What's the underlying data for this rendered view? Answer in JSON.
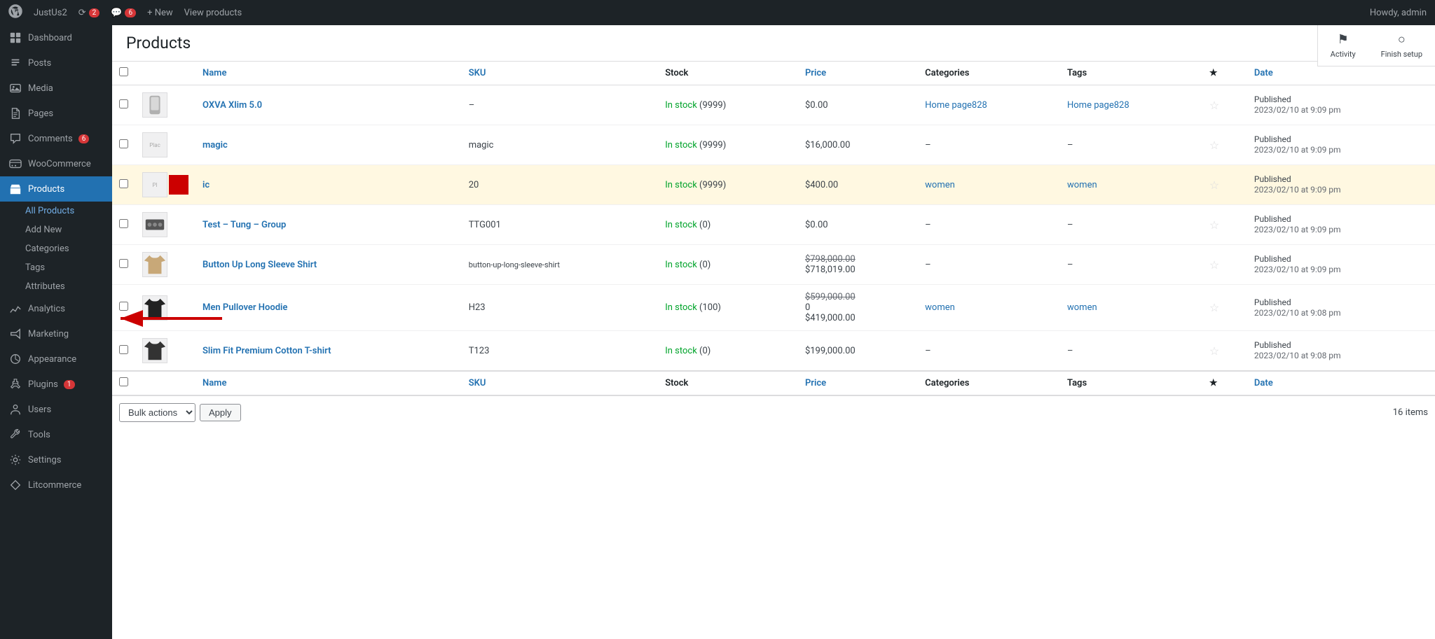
{
  "adminbar": {
    "site_name": "JustUs2",
    "updates_count": "2",
    "comments_count": "6",
    "new_label": "+ New",
    "view_products": "View products",
    "howdy": "Howdy, admin"
  },
  "sidebar": {
    "items": [
      {
        "id": "dashboard",
        "label": "Dashboard",
        "icon": "dashboard"
      },
      {
        "id": "posts",
        "label": "Posts",
        "icon": "posts"
      },
      {
        "id": "media",
        "label": "Media",
        "icon": "media"
      },
      {
        "id": "pages",
        "label": "Pages",
        "icon": "pages"
      },
      {
        "id": "comments",
        "label": "Comments",
        "icon": "comments",
        "badge": "6"
      },
      {
        "id": "woocommerce",
        "label": "WooCommerce",
        "icon": "woo"
      },
      {
        "id": "products",
        "label": "Products",
        "icon": "products",
        "active": true
      }
    ],
    "submenu": [
      {
        "id": "all-products",
        "label": "All Products",
        "active": true
      },
      {
        "id": "add-new",
        "label": "Add New"
      },
      {
        "id": "categories",
        "label": "Categories"
      },
      {
        "id": "tags",
        "label": "Tags"
      },
      {
        "id": "attributes",
        "label": "Attributes"
      }
    ],
    "bottom_items": [
      {
        "id": "analytics",
        "label": "Analytics",
        "icon": "analytics"
      },
      {
        "id": "marketing",
        "label": "Marketing",
        "icon": "marketing"
      },
      {
        "id": "appearance",
        "label": "Appearance",
        "icon": "appearance"
      },
      {
        "id": "plugins",
        "label": "Plugins",
        "icon": "plugins",
        "badge": "1"
      },
      {
        "id": "users",
        "label": "Users",
        "icon": "users"
      },
      {
        "id": "tools",
        "label": "Tools",
        "icon": "tools"
      },
      {
        "id": "settings",
        "label": "Settings",
        "icon": "settings"
      },
      {
        "id": "litcommerce",
        "label": "Litcommerce",
        "icon": "litcommerce"
      }
    ]
  },
  "page": {
    "title": "Products"
  },
  "top_right": {
    "activity_label": "Activity",
    "finish_setup_label": "Finish setup"
  },
  "table": {
    "columns": [
      "",
      "",
      "Name",
      "SKU",
      "Stock",
      "Price",
      "Categories",
      "Tags",
      "★",
      "Date"
    ],
    "rows": [
      {
        "id": 1,
        "name": "OXVA Xlim 5.0",
        "sku": "–",
        "stock": "In stock",
        "stock_qty": "(9999)",
        "price": "$0.00",
        "price_sale": null,
        "price_extra": null,
        "categories": "Home page828",
        "tags": "Home page828",
        "starred": false,
        "date": "Published",
        "date_val": "2023/02/10 at 9:09 pm",
        "img_type": "device"
      },
      {
        "id": 2,
        "name": "magic",
        "sku": "magic",
        "stock": "In stock",
        "stock_qty": "(9999)",
        "price": "$16,000.00",
        "price_sale": null,
        "price_extra": null,
        "categories": "–",
        "tags": "–",
        "starred": false,
        "date": "Published",
        "date_val": "2023/02/10 at 9:09 pm",
        "img_type": "placeholder"
      },
      {
        "id": 3,
        "name": "ic",
        "sku": "20",
        "stock": "In stock",
        "stock_qty": "(9999)",
        "price": "$400.00",
        "price_sale": null,
        "price_extra": null,
        "categories": "women",
        "tags": "women",
        "starred": false,
        "date": "Published",
        "date_val": "2023/02/10 at 9:09 pm",
        "img_type": "placeholder",
        "highlighted": true,
        "red_block": true
      },
      {
        "id": 4,
        "name": "Test – Tung – Group",
        "sku": "TTG001",
        "stock": "In stock",
        "stock_qty": "(0)",
        "price": "$0.00",
        "price_sale": null,
        "price_extra": null,
        "categories": "–",
        "tags": "–",
        "starred": false,
        "date": "Published",
        "date_val": "2023/02/10 at 9:09 pm",
        "img_type": "group"
      },
      {
        "id": 5,
        "name": "Button Up Long Sleeve Shirt",
        "sku": "button-up-long-sleeve-shirt",
        "stock": "In stock",
        "stock_qty": "(0)",
        "price": "$798,000.00",
        "price_sale": "$718,019.00",
        "price_extra": null,
        "categories": "–",
        "tags": "–",
        "starred": false,
        "date": "Published",
        "date_val": "2023/02/10 at 9:09 pm",
        "img_type": "shirt"
      },
      {
        "id": 6,
        "name": "Men Pullover Hoodie",
        "sku": "H23",
        "stock": "In stock",
        "stock_qty": "(100)",
        "price": "$599,000.00",
        "price_mid": "0",
        "price_sale": "$419,000.00",
        "price_extra": null,
        "categories": "women",
        "tags": "women",
        "starred": false,
        "date": "Published",
        "date_val": "2023/02/10 at 9:08 pm",
        "img_type": "hoodie"
      },
      {
        "id": 7,
        "name": "Slim Fit Premium Cotton T-shirt",
        "sku": "T123",
        "stock": "In stock",
        "stock_qty": "(0)",
        "price": "$199,000.00",
        "price_sale": null,
        "price_extra": null,
        "categories": "–",
        "tags": "–",
        "starred": false,
        "date": "Published",
        "date_val": "2023/02/10 at 9:08 pm",
        "img_type": "tshirt"
      }
    ],
    "footer_columns": [
      "",
      "",
      "Name",
      "SKU",
      "Stock",
      "Price",
      "Categories",
      "Tags",
      "★",
      "Date"
    ]
  },
  "bulk_actions": {
    "label": "Bulk actions",
    "apply_label": "Apply",
    "items_count": "16 items"
  }
}
